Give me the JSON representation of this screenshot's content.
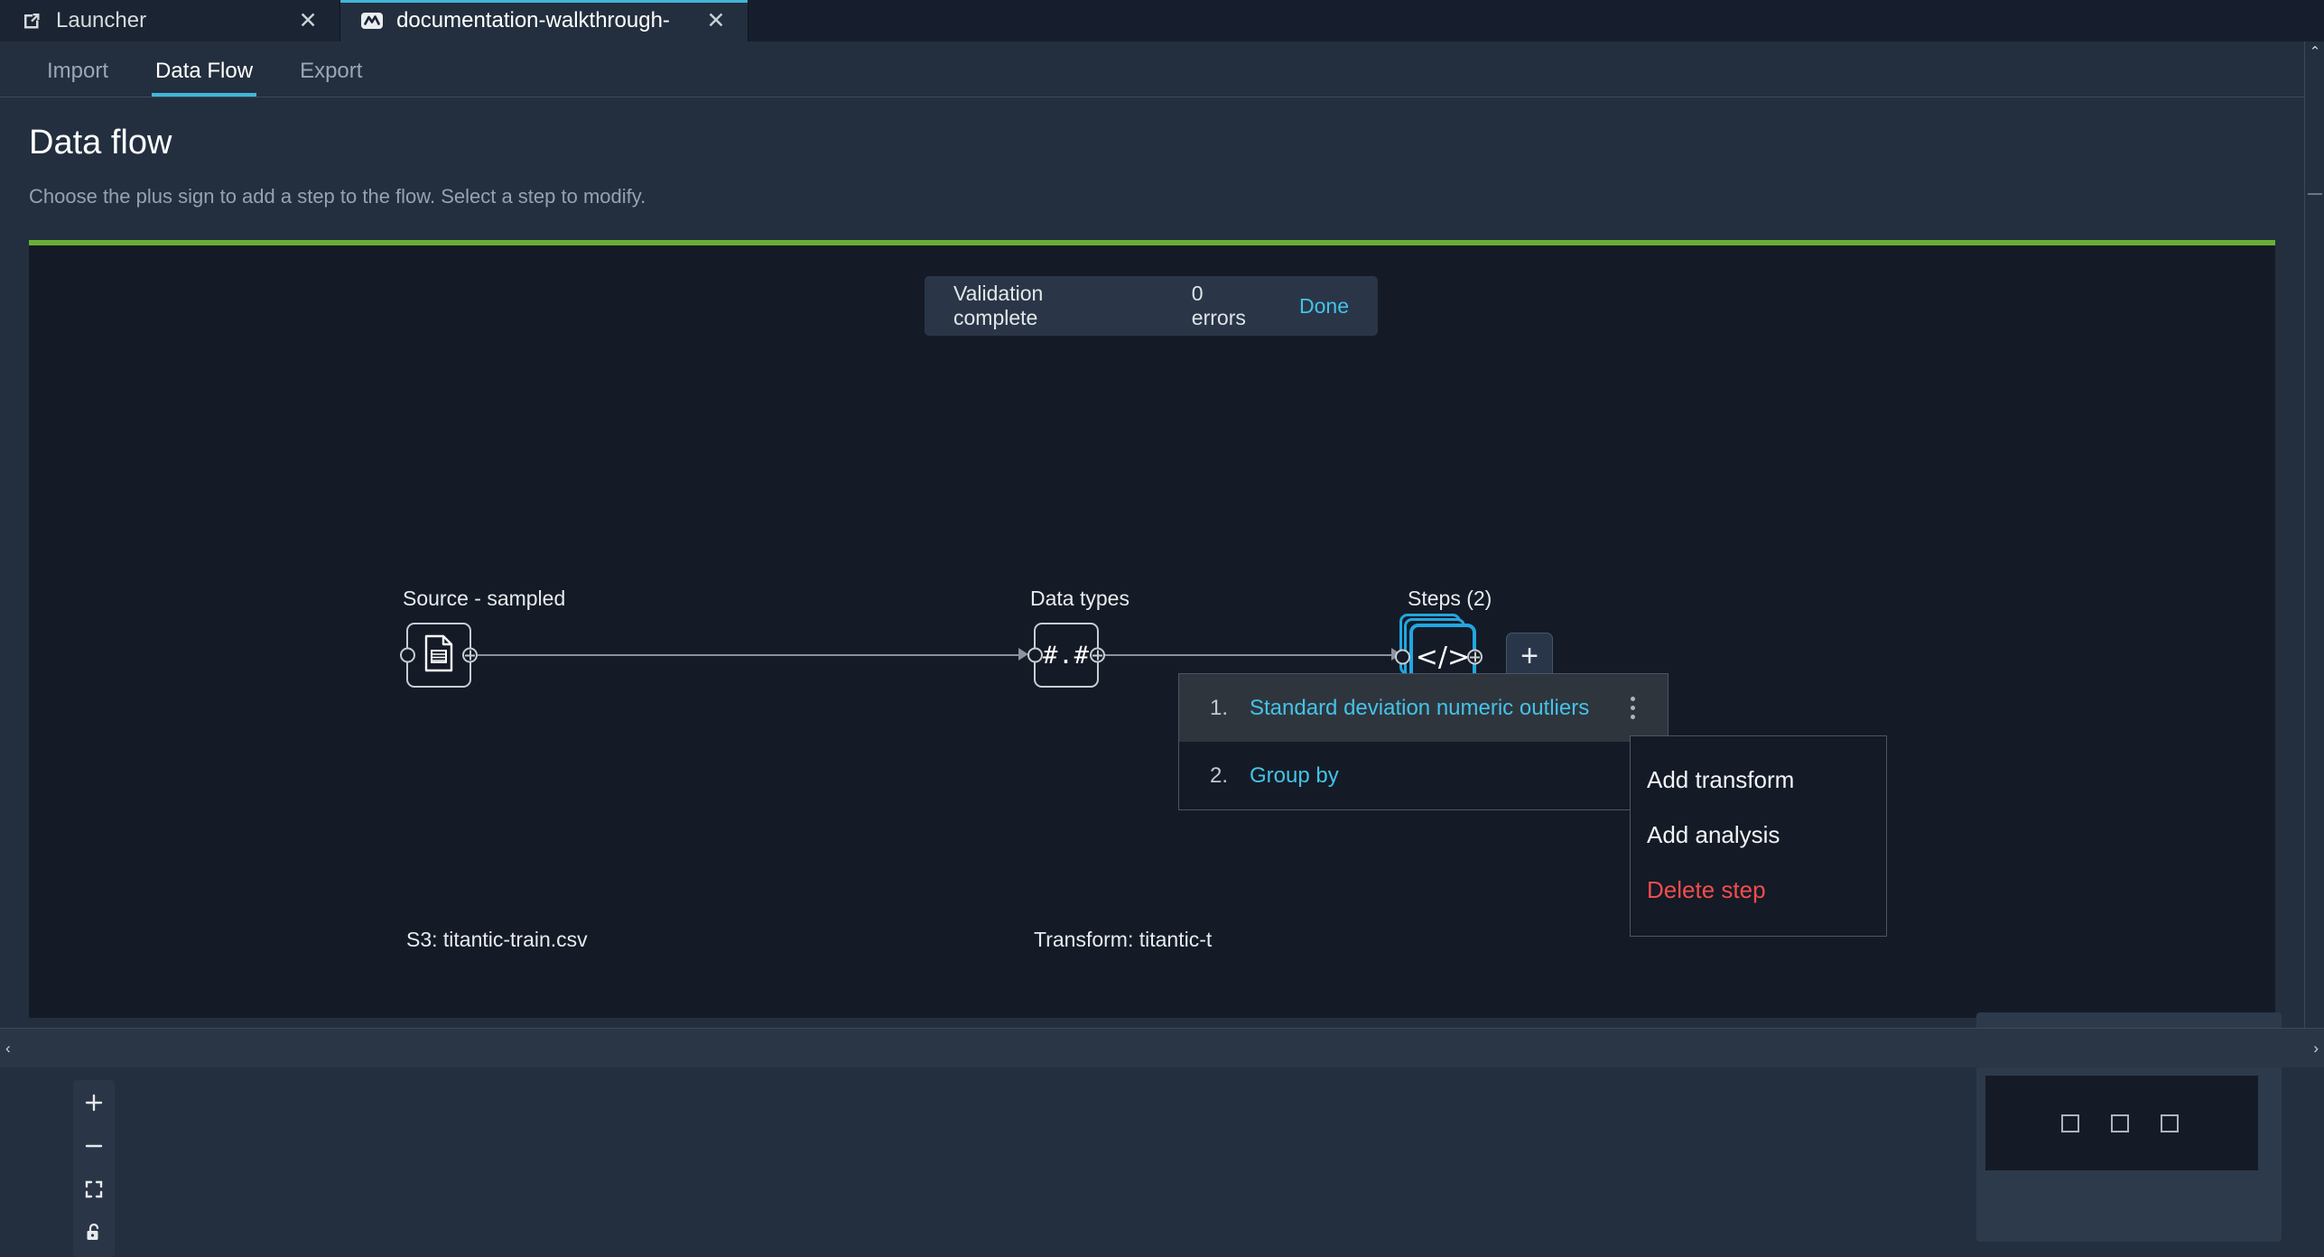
{
  "tabs": [
    {
      "label": "Launcher",
      "icon": "external-link-icon",
      "active": false,
      "close": "✕"
    },
    {
      "label": "documentation-walkthrough-",
      "icon": "data-wrangler-icon",
      "active": true,
      "close": "✕"
    }
  ],
  "subnav": {
    "items": [
      {
        "label": "Import",
        "active": false
      },
      {
        "label": "Data Flow",
        "active": true
      },
      {
        "label": "Export",
        "active": false
      }
    ]
  },
  "page": {
    "title": "Data flow",
    "subtitle": "Choose the plus sign to add a step to the flow. Select a step to modify."
  },
  "toast": {
    "message": "Validation complete",
    "errors": "0 errors",
    "action": "Done"
  },
  "flow": {
    "nodes": [
      {
        "caption": "Source - sampled",
        "glyph": "document-icon",
        "sublabel": "S3: titantic-train.csv"
      },
      {
        "caption": "Data types",
        "glyph": "#.#",
        "sublabel": "Transform: titantic-t"
      },
      {
        "caption": "Steps (2)",
        "glyph": "</>",
        "sublabel": ""
      }
    ],
    "add_node_label": "+"
  },
  "steps_panel": {
    "rows": [
      {
        "num": "1.",
        "name": "Standard deviation numeric outliers",
        "hovered": true
      },
      {
        "num": "2.",
        "name": "Group by",
        "hovered": false
      }
    ]
  },
  "context_menu": {
    "items": [
      {
        "label": "Add transform",
        "danger": false
      },
      {
        "label": "Add analysis",
        "danger": false
      },
      {
        "label": "Delete step",
        "danger": true
      }
    ]
  },
  "zoom_controls": [
    {
      "name": "zoom-in-button",
      "glyph": "+"
    },
    {
      "name": "zoom-out-button",
      "glyph": "—"
    },
    {
      "name": "fit-screen-button",
      "glyph": "fit-icon"
    },
    {
      "name": "lock-button",
      "glyph": "unlocked-padlock-icon"
    }
  ],
  "scrollbars": {
    "vertical_up_arrow": "⌃",
    "horizontal_left_arrow": "‹",
    "horizontal_right_arrow": "›"
  },
  "colors": {
    "accent": "#41b6d9",
    "link": "#44c3e8",
    "danger": "#f24d4d",
    "success_bar": "#6aaf35",
    "chrome": "#232f3e",
    "canvas": "#151b26",
    "selected_node_border": "#22a7e0"
  }
}
